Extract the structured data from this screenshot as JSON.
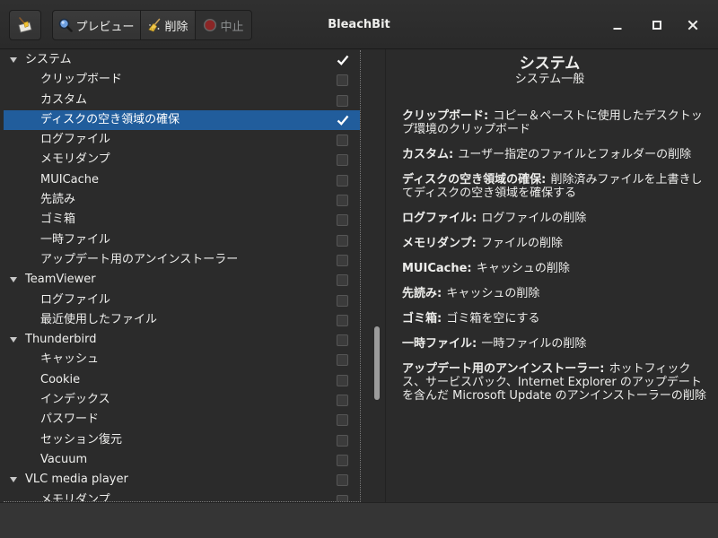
{
  "window": {
    "title": "BleachBit"
  },
  "toolbar": {
    "app_icon": "bleachbit-logo-icon",
    "buttons": [
      {
        "label": "プレビュー",
        "icon": "magnifier-icon",
        "enabled": true
      },
      {
        "label": "削除",
        "icon": "broom-icon",
        "enabled": true
      },
      {
        "label": "中止",
        "icon": "stop-icon",
        "enabled": false
      }
    ]
  },
  "window_controls": [
    {
      "icon": "minimize-icon"
    },
    {
      "icon": "maximize-icon"
    },
    {
      "icon": "close-icon"
    }
  ],
  "tree": {
    "rows": [
      {
        "label": "システム",
        "level": 0,
        "expanded": true,
        "checked": true
      },
      {
        "label": "クリップボード",
        "level": 1,
        "checked": false
      },
      {
        "label": "カスタム",
        "level": 1,
        "checked": false
      },
      {
        "label": "ディスクの空き領域の確保",
        "level": 1,
        "checked": true,
        "selected": true
      },
      {
        "label": "ログファイル",
        "level": 1,
        "checked": false
      },
      {
        "label": "メモリダンプ",
        "level": 1,
        "checked": false
      },
      {
        "label": "MUICache",
        "level": 1,
        "checked": false
      },
      {
        "label": "先読み",
        "level": 1,
        "checked": false
      },
      {
        "label": "ゴミ箱",
        "level": 1,
        "checked": false
      },
      {
        "label": "一時ファイル",
        "level": 1,
        "checked": false
      },
      {
        "label": "アップデート用のアンインストーラー",
        "level": 1,
        "checked": false
      },
      {
        "label": "TeamViewer",
        "level": 0,
        "expanded": true,
        "checked": false
      },
      {
        "label": "ログファイル",
        "level": 1,
        "checked": false
      },
      {
        "label": "最近使用したファイル",
        "level": 1,
        "checked": false
      },
      {
        "label": "Thunderbird",
        "level": 0,
        "expanded": true,
        "checked": false
      },
      {
        "label": "キャッシュ",
        "level": 1,
        "checked": false
      },
      {
        "label": "Cookie",
        "level": 1,
        "checked": false
      },
      {
        "label": "インデックス",
        "level": 1,
        "checked": false
      },
      {
        "label": "パスワード",
        "level": 1,
        "checked": false
      },
      {
        "label": "セッション復元",
        "level": 1,
        "checked": false
      },
      {
        "label": "Vacuum",
        "level": 1,
        "checked": false
      },
      {
        "label": "VLC media player",
        "level": 0,
        "expanded": true,
        "checked": false
      },
      {
        "label": "メモリダンプ",
        "level": 1,
        "checked": false
      }
    ]
  },
  "details": {
    "title": "システム",
    "subtitle": "システム一般",
    "entries": [
      {
        "name": "クリップボード:",
        "description": "コピー＆ペーストに使用したデスクトップ環境のクリップボード"
      },
      {
        "name": "カスタム:",
        "description": "ユーザー指定のファイルとフォルダーの削除"
      },
      {
        "name": "ディスクの空き領域の確保:",
        "description": "削除済みファイルを上書きしてディスクの空き領域を確保する"
      },
      {
        "name": "ログファイル:",
        "description": "ログファイルの削除"
      },
      {
        "name": "メモリダンプ:",
        "description": "ファイルの削除"
      },
      {
        "name": "MUICache:",
        "description": "キャッシュの削除"
      },
      {
        "name": "先読み:",
        "description": "キャッシュの削除"
      },
      {
        "name": "ゴミ箱:",
        "description": "ゴミ箱を空にする"
      },
      {
        "name": "一時ファイル:",
        "description": "一時ファイルの削除"
      },
      {
        "name": "アップデート用のアンインストーラー:",
        "description": "ホットフィックス、サービスパック、Internet Explorer のアップデートを含んだ Microsoft Update のアンインストーラーの削除"
      }
    ]
  },
  "colors": {
    "selection": "#215d9c",
    "stop_icon": "#b22222"
  }
}
